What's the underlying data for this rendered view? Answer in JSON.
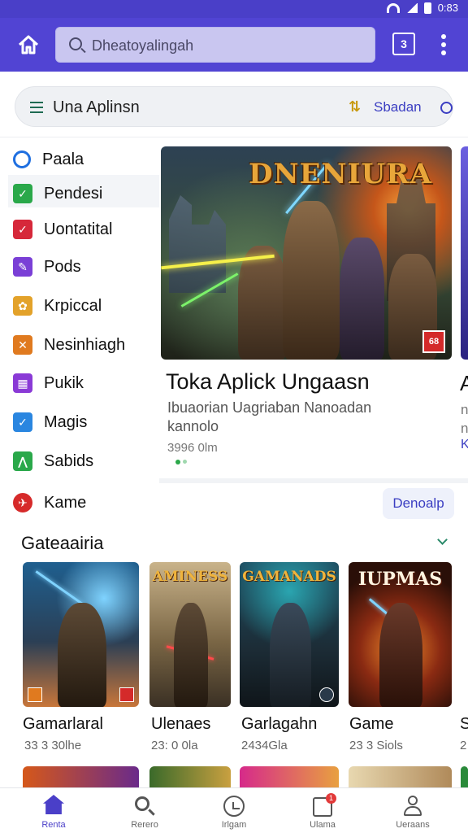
{
  "status": {
    "time": "0:83"
  },
  "appbar": {
    "search_value": "Dheatoyalingah",
    "square_label": "3"
  },
  "filter": {
    "label": "Una Aplinsn",
    "sort_label": "Sbadan"
  },
  "sidebar": {
    "items": [
      {
        "label": "Paala",
        "icon": "search-icon",
        "color": "#1f6fe0"
      },
      {
        "label": "Pendesi",
        "icon": "check-icon",
        "color": "#2aa84a"
      },
      {
        "label": "Uontatital",
        "icon": "check-mark-icon",
        "color": "#d6283a"
      },
      {
        "label": "Pods",
        "icon": "pencil-icon",
        "color": "#7a3fd6"
      },
      {
        "label": "Krpiccal",
        "icon": "gear-icon",
        "color": "#e3a22a"
      },
      {
        "label": "Nesinhiagh",
        "icon": "cross-icon",
        "color": "#e07a1f"
      },
      {
        "label": "Pukik",
        "icon": "grid-icon",
        "color": "#8a3ad6"
      },
      {
        "label": "Magis",
        "icon": "check-icon",
        "color": "#2a86e0"
      },
      {
        "label": "Sabids",
        "icon": "figure-icon",
        "color": "#2aa84a"
      },
      {
        "label": "Kame",
        "icon": "plane-icon",
        "color": "#d62a2a"
      }
    ]
  },
  "hero": {
    "art_title": "DNENIURA",
    "badge": "68",
    "title": "Toka Aplick Ungaasn",
    "desc_line1": "Ibuaorian Uagriaban Nanoadan",
    "desc_line2": "kannolo",
    "meta": "3996 0lm",
    "peek_title": "A",
    "peek_line1": "n",
    "peek_line2": "n",
    "peek_line3": "K"
  },
  "detail_button": "Denoalp",
  "section": {
    "title": "Gateaairia"
  },
  "games": [
    {
      "title": "Gamarlaral",
      "meta": "33 3 30lhe",
      "art": ""
    },
    {
      "title": "Ulenaes",
      "meta": "23: 0 0la",
      "art": "AMINESS"
    },
    {
      "title": "Garlagahn",
      "meta": "2434Gla",
      "art": "GAMANADS"
    },
    {
      "title": "Game",
      "meta": "23 3 Siols",
      "art": "IUPMAS"
    },
    {
      "title": "S",
      "meta": "2"
    }
  ],
  "bottomnav": {
    "items": [
      {
        "label": "Renta"
      },
      {
        "label": "Rerero"
      },
      {
        "label": "Irlgam"
      },
      {
        "label": "Ulama",
        "badge": "1"
      },
      {
        "label": "Ueraans"
      }
    ]
  }
}
